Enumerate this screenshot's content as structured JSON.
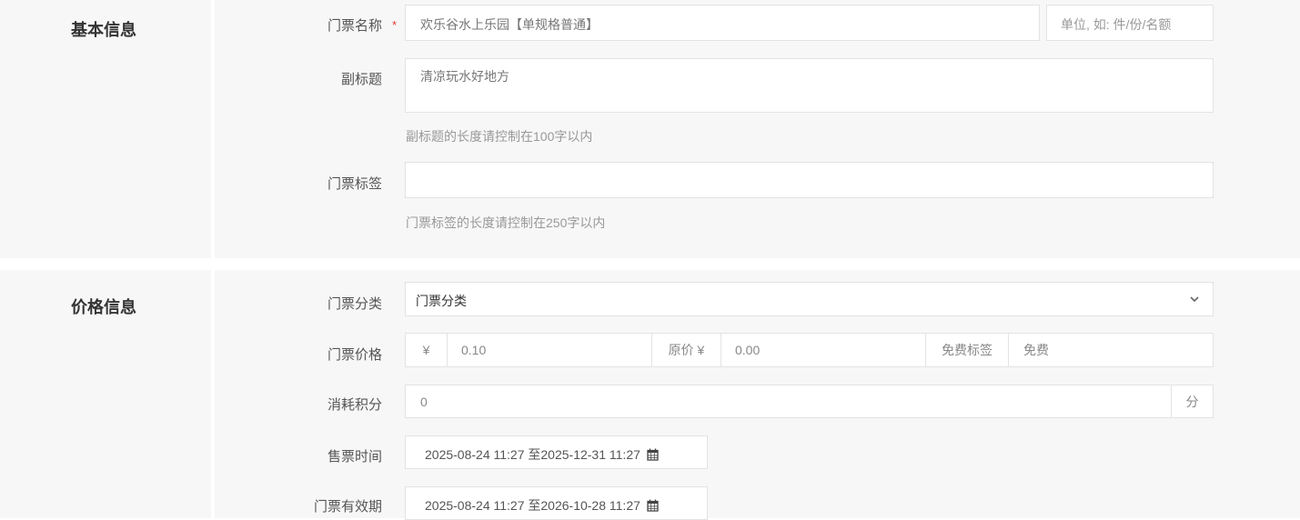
{
  "basic": {
    "title": "基本信息",
    "name_label": "门票名称",
    "required_mark": "*",
    "name_value": "欢乐谷水上乐园【单规格普通】",
    "unit_placeholder": "单位, 如: 件/份/名额",
    "subtitle_label": "副标题",
    "subtitle_value": "清凉玩水好地方",
    "subtitle_help": "副标题的长度请控制在100字以内",
    "tag_label": "门票标签",
    "tag_value": "",
    "tag_help": "门票标签的长度请控制在250字以内"
  },
  "price": {
    "title": "价格信息",
    "category_label": "门票分类",
    "category_value": "门票分类",
    "price_label": "门票价格",
    "currency_symbol": "¥",
    "price_value": "0.10",
    "original_label": "原价 ¥",
    "original_value": "0.00",
    "free_label": "免费标签",
    "free_value": "免费",
    "points_label": "消耗积分",
    "points_value": "0",
    "points_unit": "分",
    "sale_time_label": "售票时间",
    "sale_time_value": "2025-08-24 11:27 至2025-12-31 11:27",
    "valid_label": "门票有效期",
    "valid_value": "2025-08-24 11:27 至2026-10-28 11:27"
  },
  "icons": {
    "chevron": "chevron-down-icon",
    "calendar": "calendar-icon"
  }
}
